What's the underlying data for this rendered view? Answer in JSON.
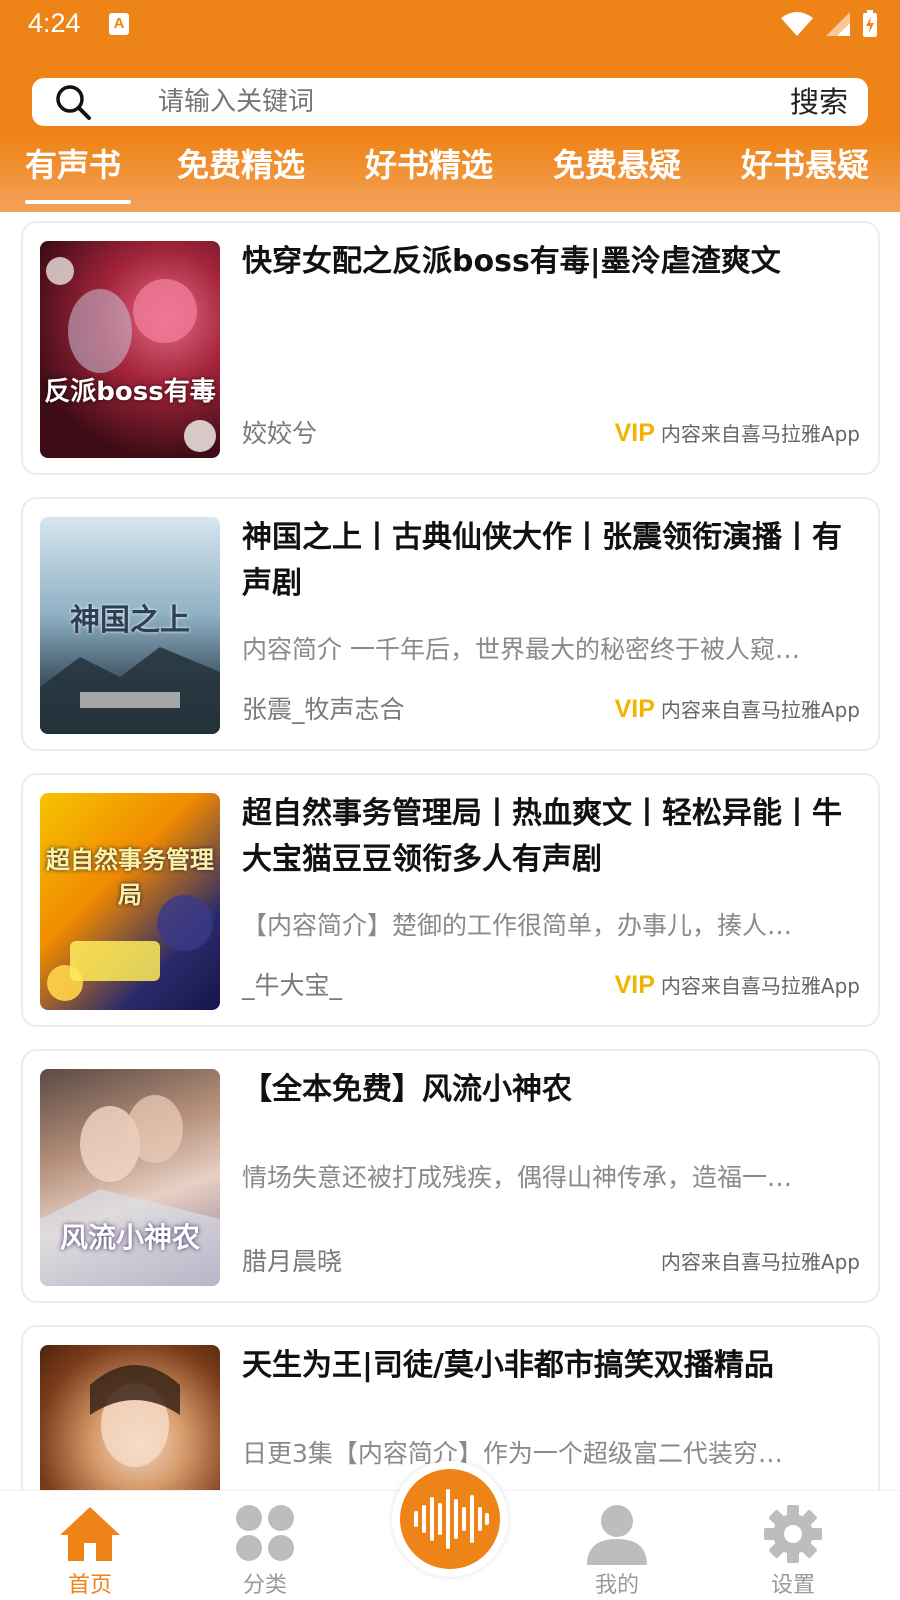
{
  "status_bar": {
    "time": "4:24",
    "app_badge": "A"
  },
  "search": {
    "placeholder": "请输入关键词",
    "button_label": "搜索"
  },
  "tabs": [
    {
      "label": "有声书",
      "active": true
    },
    {
      "label": "免费精选",
      "active": false
    },
    {
      "label": "好书精选",
      "active": false
    },
    {
      "label": "免费悬疑",
      "active": false
    },
    {
      "label": "好书悬疑",
      "active": false
    }
  ],
  "books": [
    {
      "title": "快穿女配之反派boss有毒|墨泠虐渣爽文",
      "intro": "",
      "author": "姣姣兮",
      "vip": "VIP",
      "source": "内容来自喜马拉雅App",
      "cover_text": "反派boss有毒"
    },
    {
      "title": "神国之上丨古典仙侠大作丨张震领衔演播丨有声剧",
      "intro": "内容简介 一千年后，世界最大的秘密终于被人窥…",
      "author": "张震_牧声志合",
      "vip": "VIP",
      "source": "内容来自喜马拉雅App",
      "cover_text": "神国之上"
    },
    {
      "title": "超自然事务管理局丨热血爽文丨轻松异能丨牛大宝猫豆豆领衔多人有声剧",
      "intro": "【内容简介】楚御的工作很简单，办事儿，揍人…",
      "author": "_牛大宝_",
      "vip": "VIP",
      "source": "内容来自喜马拉雅App",
      "cover_text": "超自然事务管理局"
    },
    {
      "title": "【全本免费】风流小神农",
      "intro": "情场失意还被打成残疾，偶得山神传承，造福一…",
      "author": "腊月晨晓",
      "vip": "",
      "source": "内容来自喜马拉雅App",
      "cover_text": "风流小神农"
    },
    {
      "title": "天生为王|司徒/莫小非都市搞笑双播精品",
      "intro": "日更3集【内容简介】作为一个超级富二代装穷…",
      "author": "",
      "vip": "",
      "source": "",
      "cover_text": ""
    }
  ],
  "bottom_nav": [
    {
      "label": "首页",
      "icon": "home-icon",
      "active": true
    },
    {
      "label": "分类",
      "icon": "grid-icon",
      "active": false
    },
    {
      "label": "",
      "icon": "soundwave-icon",
      "active": false
    },
    {
      "label": "我的",
      "icon": "user-icon",
      "active": false
    },
    {
      "label": "设置",
      "icon": "gear-icon",
      "active": false
    }
  ],
  "colors": {
    "accent": "#ee8417",
    "vip": "#f3b400",
    "inactive": "#bdbdbd"
  }
}
